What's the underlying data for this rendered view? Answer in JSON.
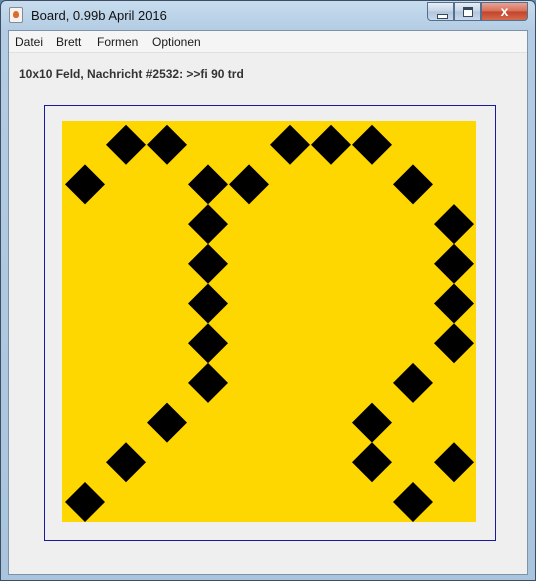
{
  "window": {
    "title": "Board, 0.99b April 2016",
    "icon": "java-cup-icon",
    "controls": {
      "minimize": "minimize",
      "maximize": "maximize",
      "close": "x"
    }
  },
  "menu": {
    "items": [
      "Datei",
      "Brett",
      "Formen",
      "Optionen"
    ]
  },
  "status": "10x10 Feld, Nachricht #2532: >>fi 90 trd",
  "board": {
    "rows": 10,
    "cols": 10,
    "background_color": "#ffd700",
    "cell_shape": "diamond",
    "cell_color": "#000000",
    "cells": [
      [
        1,
        9
      ],
      [
        2,
        9
      ],
      [
        5,
        9
      ],
      [
        6,
        9
      ],
      [
        7,
        9
      ],
      [
        0,
        8
      ],
      [
        3,
        8
      ],
      [
        4,
        8
      ],
      [
        8,
        8
      ],
      [
        3,
        7
      ],
      [
        9,
        7
      ],
      [
        3,
        6
      ],
      [
        9,
        6
      ],
      [
        3,
        5
      ],
      [
        9,
        5
      ],
      [
        3,
        4
      ],
      [
        9,
        4
      ],
      [
        3,
        3
      ],
      [
        8,
        3
      ],
      [
        2,
        2
      ],
      [
        7,
        2
      ],
      [
        1,
        1
      ],
      [
        7,
        1
      ],
      [
        9,
        1
      ],
      [
        0,
        0
      ],
      [
        8,
        0
      ]
    ]
  }
}
